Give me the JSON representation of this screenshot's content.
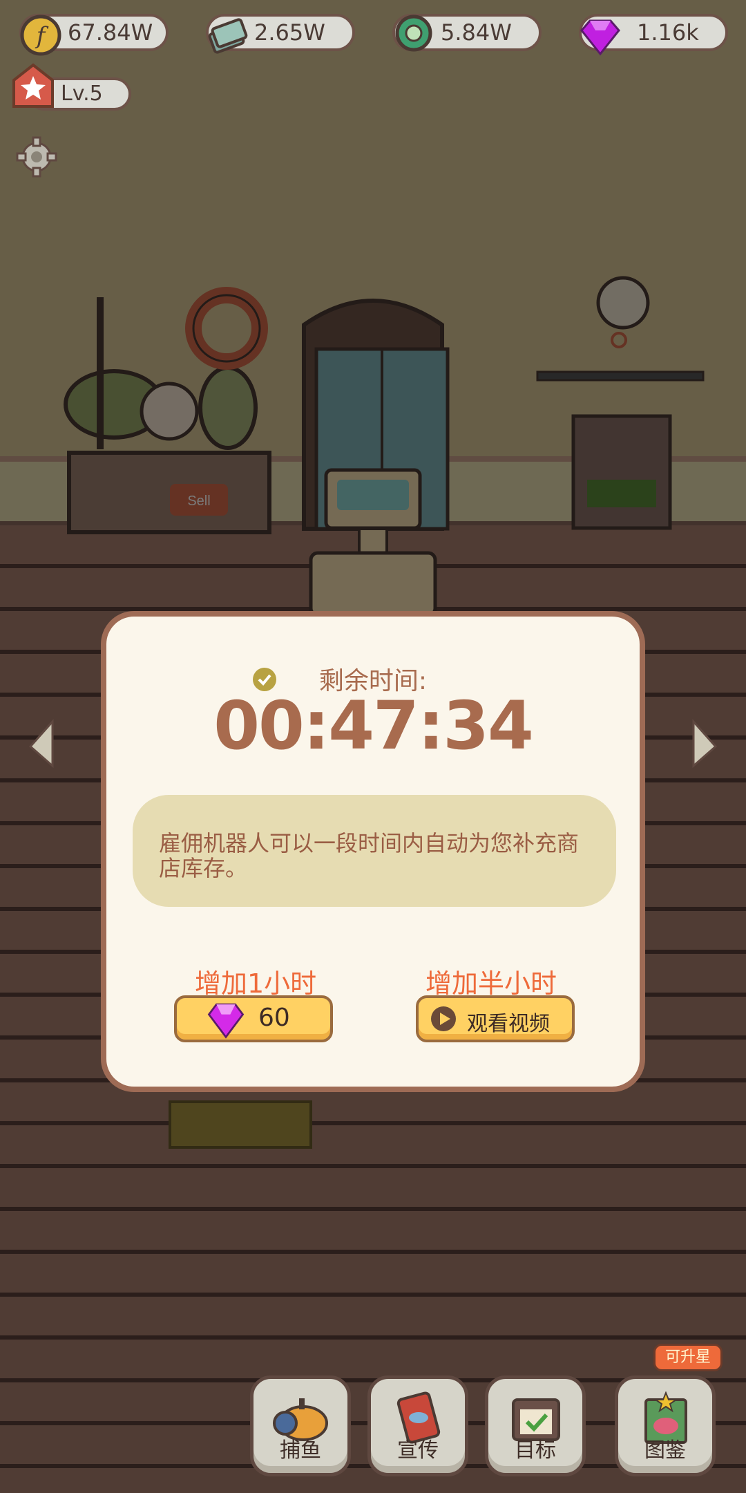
{
  "resources": [
    {
      "name": "coins",
      "value": "67.84W"
    },
    {
      "name": "banknotes",
      "value": "2.65W"
    },
    {
      "name": "shells",
      "value": "5.84W"
    },
    {
      "name": "gems",
      "value": "1.16k"
    }
  ],
  "level": "Lv.5",
  "dialog": {
    "remaining_label": "剩余时间:",
    "timer": "00:47:34",
    "description": "雇佣机器人可以一段时间内自动为您补充商店库存。",
    "option_gem": {
      "title": "增加1小时",
      "cost": "60"
    },
    "option_video": {
      "title": "增加半小时",
      "button": "观看视频"
    }
  },
  "nav": {
    "fishing": "捕鱼",
    "promote": "宣传",
    "goals": "目标",
    "catalog": "图鉴",
    "catalog_badge": "可升星"
  },
  "colors": {
    "accent_orange": "#ee6a3a",
    "timer_brown": "#a86b4e",
    "button_yellow": "#ffd163",
    "gem_purple": "#c020e0"
  }
}
